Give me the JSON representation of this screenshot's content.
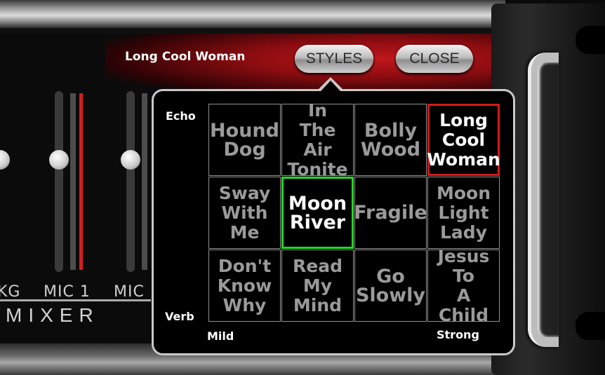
{
  "header": {
    "song_title": "Long Cool Woman",
    "styles_button": "STYLES",
    "close_button": "CLOSE"
  },
  "mixer": {
    "label": "MIXER",
    "channels": [
      "KG",
      "MIC 1",
      "MIC"
    ]
  },
  "styles_popup": {
    "axis": {
      "top_left": "Echo",
      "bottom_left": "Verb",
      "bottom_start": "Mild",
      "bottom_end": "Strong"
    },
    "grid": [
      {
        "label": "Hound Dog",
        "state": "normal"
      },
      {
        "label": "In The Air Tonite",
        "state": "normal"
      },
      {
        "label": "Bolly Wood",
        "state": "normal"
      },
      {
        "label": "Long Cool Woman",
        "state": "playing"
      },
      {
        "label": "Sway With Me",
        "state": "normal"
      },
      {
        "label": "Moon River",
        "state": "selected"
      },
      {
        "label": "Fragile",
        "state": "normal"
      },
      {
        "label": "Moon Light Lady",
        "state": "normal"
      },
      {
        "label": "Don't Know Why",
        "state": "normal"
      },
      {
        "label": "Read My Mind",
        "state": "normal"
      },
      {
        "label": "Go Slowly",
        "state": "normal"
      },
      {
        "label": "Jesus To A Child",
        "state": "normal"
      }
    ]
  },
  "colors": {
    "selected_border": "#26d726",
    "playing_border": "#d21a1a",
    "cell_text": "#9a9a9a"
  }
}
